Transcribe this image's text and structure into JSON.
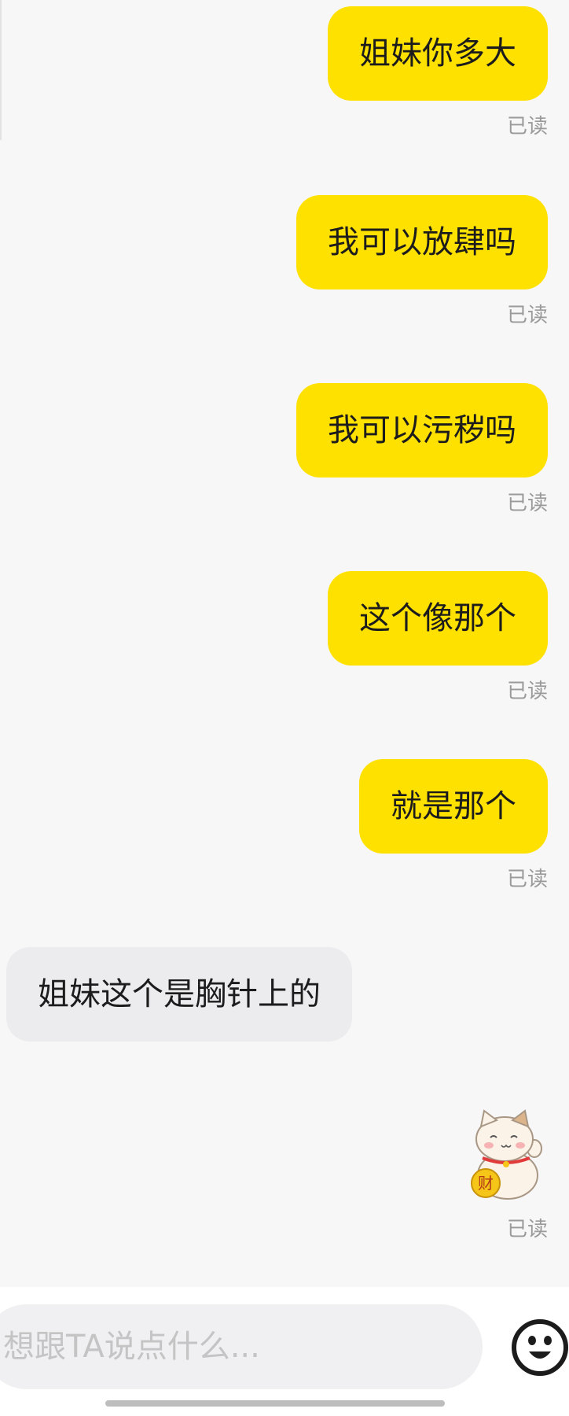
{
  "messages": [
    {
      "direction": "out",
      "text": "姐妹你多大",
      "status": "已读"
    },
    {
      "direction": "out",
      "text": "我可以放肆吗",
      "status": "已读"
    },
    {
      "direction": "out",
      "text": "我可以污秽吗",
      "status": "已读"
    },
    {
      "direction": "out",
      "text": "这个像那个",
      "status": "已读"
    },
    {
      "direction": "out",
      "text": "就是那个",
      "status": "已读"
    },
    {
      "direction": "in",
      "text": "姐妹这个是胸针上的"
    },
    {
      "direction": "out",
      "type": "sticker",
      "sticker_label": "财",
      "status": "已读"
    }
  ],
  "composer": {
    "placeholder": "想跟TA说点什么...",
    "value": "",
    "emoji_icon": "emoji-face-icon"
  },
  "colors": {
    "outgoing_bubble": "#ffe100",
    "incoming_bubble": "#ececee",
    "background": "#f7f7f7"
  }
}
